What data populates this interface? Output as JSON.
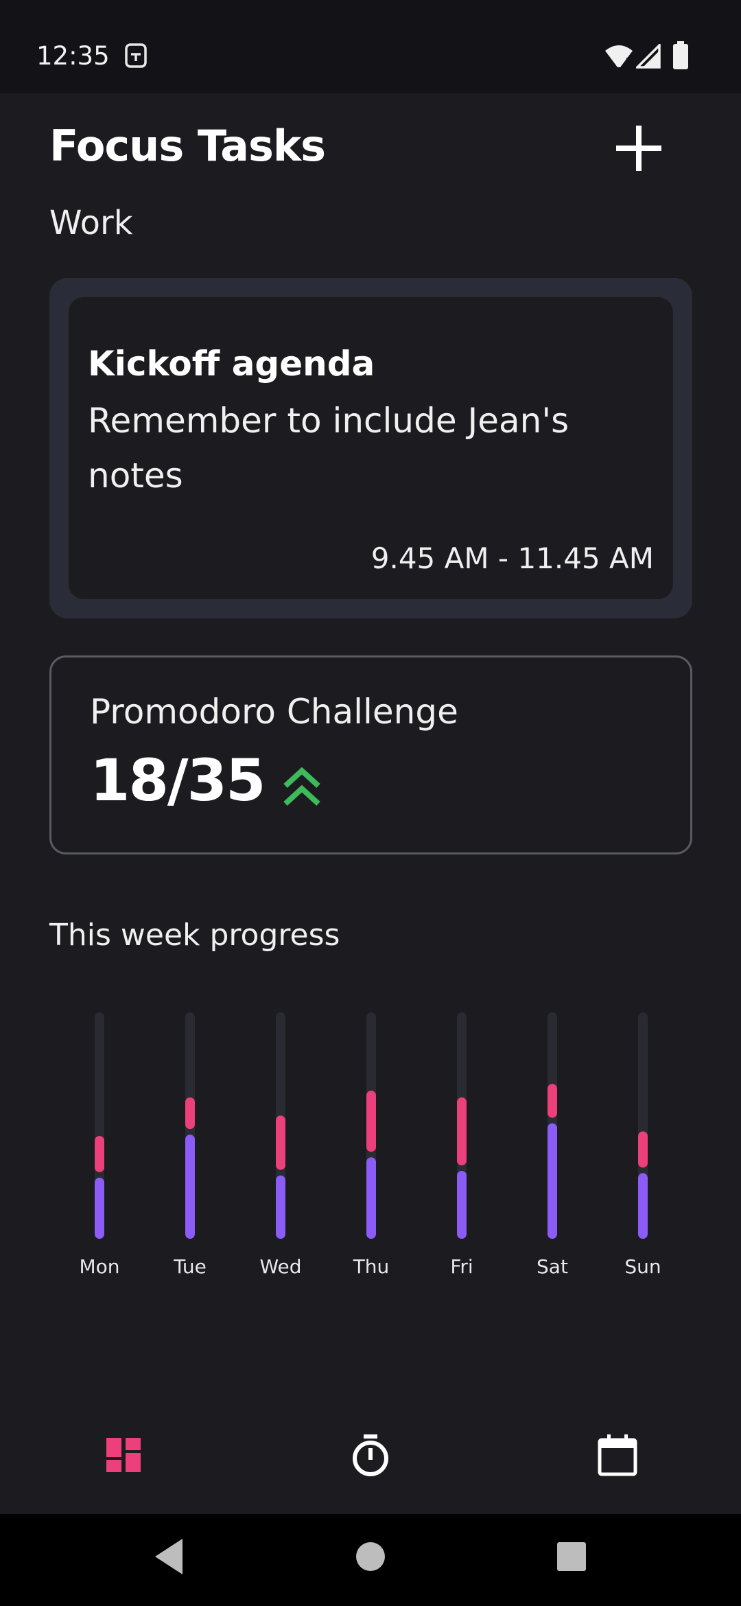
{
  "status_bar": {
    "time": "12:35",
    "icons": [
      "sim-card-icon",
      "wifi-icon",
      "signal-icon",
      "battery-icon"
    ]
  },
  "header": {
    "title": "Focus Tasks",
    "add_icon": "plus-icon"
  },
  "section": {
    "label": "Work"
  },
  "task_card": {
    "title": "Kickoff agenda",
    "note": "Remember to include Jean's notes",
    "time_range": "9.45 AM - 11.45 AM"
  },
  "promodoro": {
    "title": "Promodoro Challenge",
    "count": "18/35",
    "trend_icon": "double-chevron-up-icon",
    "trend_color": "#3dbb5a"
  },
  "progress": {
    "title": "This week progress"
  },
  "chart_data": {
    "type": "bar",
    "stacked": true,
    "categories": [
      "Mon",
      "Tue",
      "Wed",
      "Thu",
      "Fri",
      "Sat",
      "Sun"
    ],
    "series": [
      {
        "color": "#8b5cf6",
        "values": [
          0.27,
          0.46,
          0.28,
          0.36,
          0.3,
          0.51,
          0.29
        ]
      },
      {
        "color": "#ec407a",
        "values": [
          0.16,
          0.14,
          0.24,
          0.27,
          0.3,
          0.15,
          0.16
        ]
      }
    ],
    "ylim": [
      0,
      1
    ],
    "track_color": "#2a2a32"
  },
  "bottom_nav": {
    "items": [
      {
        "icon": "dashboard-icon",
        "active": true
      },
      {
        "icon": "timer-icon",
        "active": false
      },
      {
        "icon": "calendar-icon",
        "active": false
      }
    ],
    "active_color": "#ec407a"
  },
  "system_nav": {
    "icons": [
      "back-icon",
      "home-icon",
      "recents-icon"
    ]
  }
}
